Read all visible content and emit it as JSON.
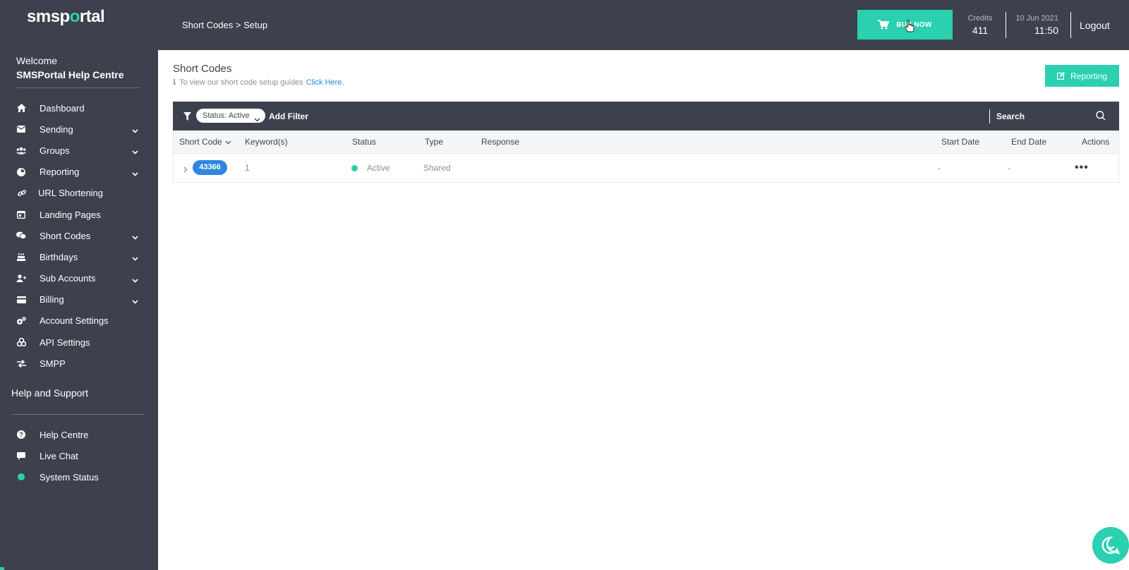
{
  "sidebar": {
    "logo_prefix": "smsp",
    "logo_o": "o",
    "logo_suffix": "rtal",
    "welcome": "Welcome",
    "account_name": "SMSPortal Help Centre",
    "nav": [
      {
        "label": "Dashboard",
        "icon": "home-icon",
        "has_children": false
      },
      {
        "label": "Sending",
        "icon": "envelope-icon",
        "has_children": true
      },
      {
        "label": "Groups",
        "icon": "users-icon",
        "has_children": true
      },
      {
        "label": "Reporting",
        "icon": "chart-pie-icon",
        "has_children": true
      },
      {
        "label": "URL Shortening",
        "icon": "link-icon",
        "has_children": false
      },
      {
        "label": "Landing Pages",
        "icon": "window-icon",
        "has_children": false
      },
      {
        "label": "Short Codes",
        "icon": "chat-bubbles-icon",
        "has_children": true
      },
      {
        "label": "Birthdays",
        "icon": "cake-icon",
        "has_children": true
      },
      {
        "label": "Sub Accounts",
        "icon": "user-plus-icon",
        "has_children": true
      },
      {
        "label": "Billing",
        "icon": "credit-card-icon",
        "has_children": true
      },
      {
        "label": "Account Settings",
        "icon": "cogs-icon",
        "has_children": false
      },
      {
        "label": "API Settings",
        "icon": "api-icon",
        "has_children": false
      },
      {
        "label": "SMPP",
        "icon": "exchange-icon",
        "has_children": false
      }
    ],
    "help_title": "Help and Support",
    "help_nav": [
      {
        "label": "Help Centre",
        "icon": "question-circle-icon"
      },
      {
        "label": "Live Chat",
        "icon": "comment-icon"
      },
      {
        "label": "System Status",
        "icon": "status-dot-icon"
      }
    ]
  },
  "topbar": {
    "breadcrumb": "Short Codes > Setup",
    "buy_now": "BUY NOW",
    "credits_label": "Credits",
    "credits_value": "411",
    "date": "10 Jun 2021",
    "time": "11:50",
    "logout": "Logout"
  },
  "main": {
    "title": "Short Codes",
    "guide_text": "To view our short code setup guides",
    "guide_link": "Click Here.",
    "reporting_button": "Reporting",
    "filter": {
      "chip_label": "Status: Active",
      "add_filter": "Add Filter",
      "search_placeholder": "Search"
    },
    "table": {
      "columns": [
        "Short Code",
        "Keyword(s)",
        "Status",
        "Type",
        "Response",
        "Start Date",
        "End Date",
        "Actions"
      ],
      "rows": [
        {
          "short_code": "43366",
          "keywords": "1",
          "status": "Active",
          "type": "Shared",
          "response": "",
          "start_date": "-",
          "end_date": "-",
          "actions": "•••"
        }
      ]
    }
  },
  "colors": {
    "sidebar_bg": "#3d414d",
    "accent": "#2ad0b0",
    "code_pill": "#2f86e0",
    "status_active": "#2ad0a5"
  }
}
